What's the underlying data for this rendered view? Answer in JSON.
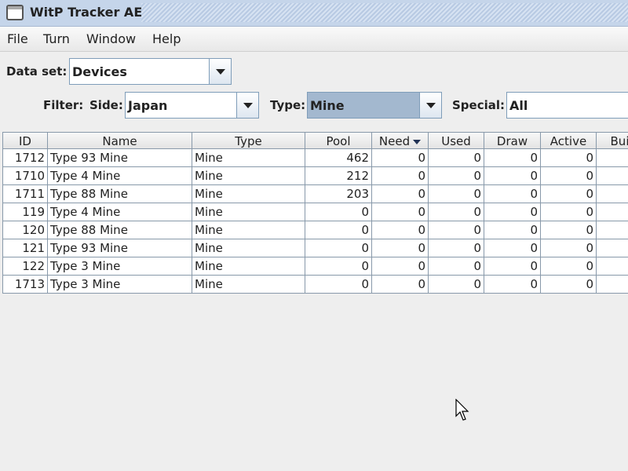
{
  "window": {
    "title": "WitP Tracker AE"
  },
  "menu": [
    {
      "label": "File"
    },
    {
      "label": "Turn"
    },
    {
      "label": "Window"
    },
    {
      "label": "Help"
    }
  ],
  "dataset": {
    "label": "Data set:",
    "value": "Devices"
  },
  "filter": {
    "label": "Filter:",
    "side_label": "Side:",
    "side_value": "Japan",
    "type_label": "Type:",
    "type_value": "Mine",
    "special_label": "Special:",
    "special_value": "All"
  },
  "table": {
    "columns": [
      "ID",
      "Name",
      "Type",
      "Pool",
      "Need",
      "Used",
      "Draw",
      "Active",
      "Bui"
    ],
    "rows": [
      [
        "1712",
        "Type 93 Mine",
        "Mine",
        "462",
        "0",
        "0",
        "0",
        "0"
      ],
      [
        "1710",
        "Type 4 Mine",
        "Mine",
        "212",
        "0",
        "0",
        "0",
        "0"
      ],
      [
        "1711",
        "Type 88 Mine",
        "Mine",
        "203",
        "0",
        "0",
        "0",
        "0"
      ],
      [
        "119",
        "Type 4 Mine",
        "Mine",
        "0",
        "0",
        "0",
        "0",
        "0"
      ],
      [
        "120",
        "Type 88 Mine",
        "Mine",
        "0",
        "0",
        "0",
        "0",
        "0"
      ],
      [
        "121",
        "Type 93 Mine",
        "Mine",
        "0",
        "0",
        "0",
        "0",
        "0"
      ],
      [
        "122",
        "Type 3 Mine",
        "Mine",
        "0",
        "0",
        "0",
        "0",
        "0"
      ],
      [
        "1713",
        "Type 3 Mine",
        "Mine",
        "0",
        "0",
        "0",
        "0",
        "0"
      ]
    ]
  }
}
